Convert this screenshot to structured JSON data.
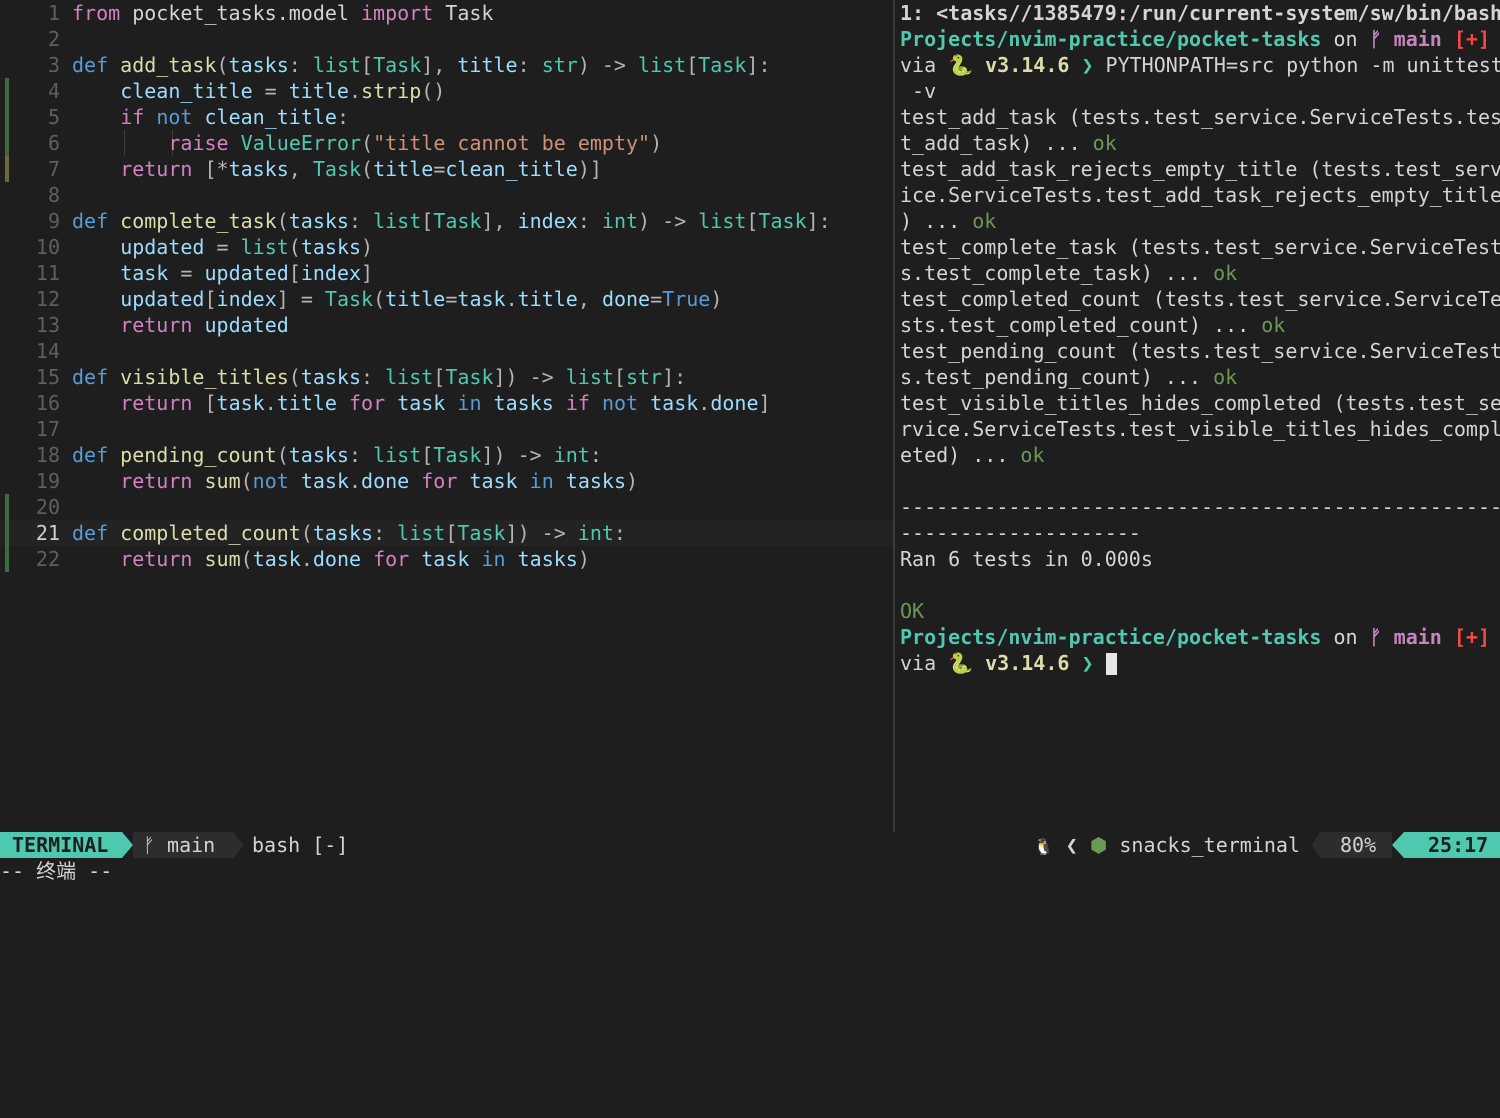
{
  "editor": {
    "current_line": "21",
    "lines": [
      {
        "n": "1"
      },
      {
        "n": "2"
      },
      {
        "n": "3"
      },
      {
        "n": "4"
      },
      {
        "n": "5"
      },
      {
        "n": "6"
      },
      {
        "n": "7"
      },
      {
        "n": "8"
      },
      {
        "n": "9"
      },
      {
        "n": "10"
      },
      {
        "n": "11"
      },
      {
        "n": "12"
      },
      {
        "n": "13"
      },
      {
        "n": "14"
      },
      {
        "n": "15"
      },
      {
        "n": "16"
      },
      {
        "n": "17"
      },
      {
        "n": "18"
      },
      {
        "n": "19"
      },
      {
        "n": "20"
      },
      {
        "n": "21"
      },
      {
        "n": "22"
      }
    ],
    "code": {
      "l1": [
        "from",
        " pocket_tasks.model ",
        "import",
        " Task"
      ],
      "l3": [
        "def",
        " ",
        "add_task",
        "(",
        "tasks",
        ": ",
        "list",
        "[",
        "Task",
        "], ",
        "title",
        ": ",
        "str",
        ") -> ",
        "list",
        "[",
        "Task",
        "]:"
      ],
      "l4": [
        "clean_title",
        " = ",
        "title",
        ".",
        "strip",
        "()"
      ],
      "l5": [
        "if",
        " ",
        "not",
        " ",
        "clean_title",
        ":"
      ],
      "l6": [
        "raise",
        " ",
        "ValueError",
        "(",
        "\"title cannot be empty\"",
        ")"
      ],
      "l7": [
        "return",
        " [*",
        "tasks",
        ", ",
        "Task",
        "(",
        "title",
        "=",
        "clean_title",
        ")]"
      ],
      "l9": [
        "def",
        " ",
        "complete_task",
        "(",
        "tasks",
        ": ",
        "list",
        "[",
        "Task",
        "], ",
        "index",
        ": ",
        "int",
        ") -> ",
        "list",
        "[",
        "Task",
        "]:"
      ],
      "l10": [
        "updated",
        " = ",
        "list",
        "(",
        "tasks",
        ")"
      ],
      "l11": [
        "task",
        " = ",
        "updated",
        "[",
        "index",
        "]"
      ],
      "l12": [
        "updated",
        "[",
        "index",
        "] = ",
        "Task",
        "(",
        "title",
        "=",
        "task",
        ".",
        "title",
        ", ",
        "done",
        "=",
        "True",
        ")"
      ],
      "l13": [
        "return",
        " ",
        "updated"
      ],
      "l15": [
        "def",
        " ",
        "visible_titles",
        "(",
        "tasks",
        ": ",
        "list",
        "[",
        "Task",
        "]) -> ",
        "list",
        "[",
        "str",
        "]:"
      ],
      "l16": [
        "return",
        " [",
        "task",
        ".",
        "title",
        " ",
        "for",
        " ",
        "task",
        " ",
        "in",
        " ",
        "tasks",
        " ",
        "if",
        " ",
        "not",
        " ",
        "task",
        ".",
        "done",
        "]"
      ],
      "l18": [
        "def",
        " ",
        "pending_count",
        "(",
        "tasks",
        ": ",
        "list",
        "[",
        "Task",
        "]) -> ",
        "int",
        ":"
      ],
      "l19": [
        "return",
        " ",
        "sum",
        "(",
        "not",
        " ",
        "task",
        ".",
        "done",
        " ",
        "for",
        " ",
        "task",
        " ",
        "in",
        " ",
        "tasks",
        ")"
      ],
      "l21": [
        "def",
        " ",
        "completed_count",
        "(",
        "tasks",
        ": ",
        "list",
        "[",
        "Task",
        "]) -> ",
        "int",
        ":"
      ],
      "l22": [
        "return",
        " ",
        "sum",
        "(",
        "task",
        ".",
        "done",
        " ",
        "for",
        " ",
        "task",
        " ",
        "in",
        " ",
        "tasks",
        ")"
      ]
    }
  },
  "terminal": {
    "title_line": "1: <tasks//1385479:/run/current-system/sw/bin/bash",
    "prompt1": {
      "path": "Projects/nvim-practice/pocket-tasks",
      "on": " on ",
      "branch_icon": "ᚠ",
      "branch": " main",
      "status": " [+]"
    },
    "via1": {
      "via": "via ",
      "snake": "🐍",
      "version": " v3.14.6",
      "chevron": " ❯ ",
      "command": "PYTHONPATH=src python -m unittest"
    },
    "command_wrap": " -v",
    "output": [
      {
        "text": "test_add_task (tests.test_service.ServiceTests.tes",
        "ok": ""
      },
      {
        "text": "t_add_task) ... ",
        "ok": "ok"
      },
      {
        "text": "test_add_task_rejects_empty_title (tests.test_serv",
        "ok": ""
      },
      {
        "text": "ice.ServiceTests.test_add_task_rejects_empty_title",
        "ok": ""
      },
      {
        "text": ") ... ",
        "ok": "ok"
      },
      {
        "text": "test_complete_task (tests.test_service.ServiceTest",
        "ok": ""
      },
      {
        "text": "s.test_complete_task) ... ",
        "ok": "ok"
      },
      {
        "text": "test_completed_count (tests.test_service.ServiceTe",
        "ok": ""
      },
      {
        "text": "sts.test_completed_count) ... ",
        "ok": "ok"
      },
      {
        "text": "test_pending_count (tests.test_service.ServiceTest",
        "ok": ""
      },
      {
        "text": "s.test_pending_count) ... ",
        "ok": "ok"
      },
      {
        "text": "test_visible_titles_hides_completed (tests.test_se",
        "ok": ""
      },
      {
        "text": "rvice.ServiceTests.test_visible_titles_hides_compl",
        "ok": ""
      },
      {
        "text": "eted) ... ",
        "ok": "ok"
      }
    ],
    "separator1": "----------------------------------------------------",
    "separator2": "--------------------",
    "ran": "Ran 6 tests in 0.000s",
    "result": "OK",
    "prompt2": {
      "path": "Projects/nvim-practice/pocket-tasks",
      "on": " on ",
      "branch_icon": "ᚠ",
      "branch": " main",
      "status": " [+]"
    },
    "via2": {
      "via": "via ",
      "snake": "🐍",
      "version": " v3.14.6",
      "chevron": " ❯ "
    }
  },
  "statusline": {
    "mode": "TERMINAL",
    "branch_icon": "ᚠ",
    "branch": " main",
    "file": "bash [-]",
    "linux_icon": "🐧",
    "lsp_chevron": "❮",
    "ft_icon": "⬢",
    "filetype": " snacks_terminal",
    "percent": "80%",
    "position": "25:17"
  },
  "cmdline": "-- 终端 --",
  "colors": {
    "accent": "#4ec9b0",
    "background": "#1e1e1e",
    "keyword": "#d381c3",
    "function": "#dcdcaa",
    "string": "#ce9178",
    "ok": "#6a9955"
  }
}
